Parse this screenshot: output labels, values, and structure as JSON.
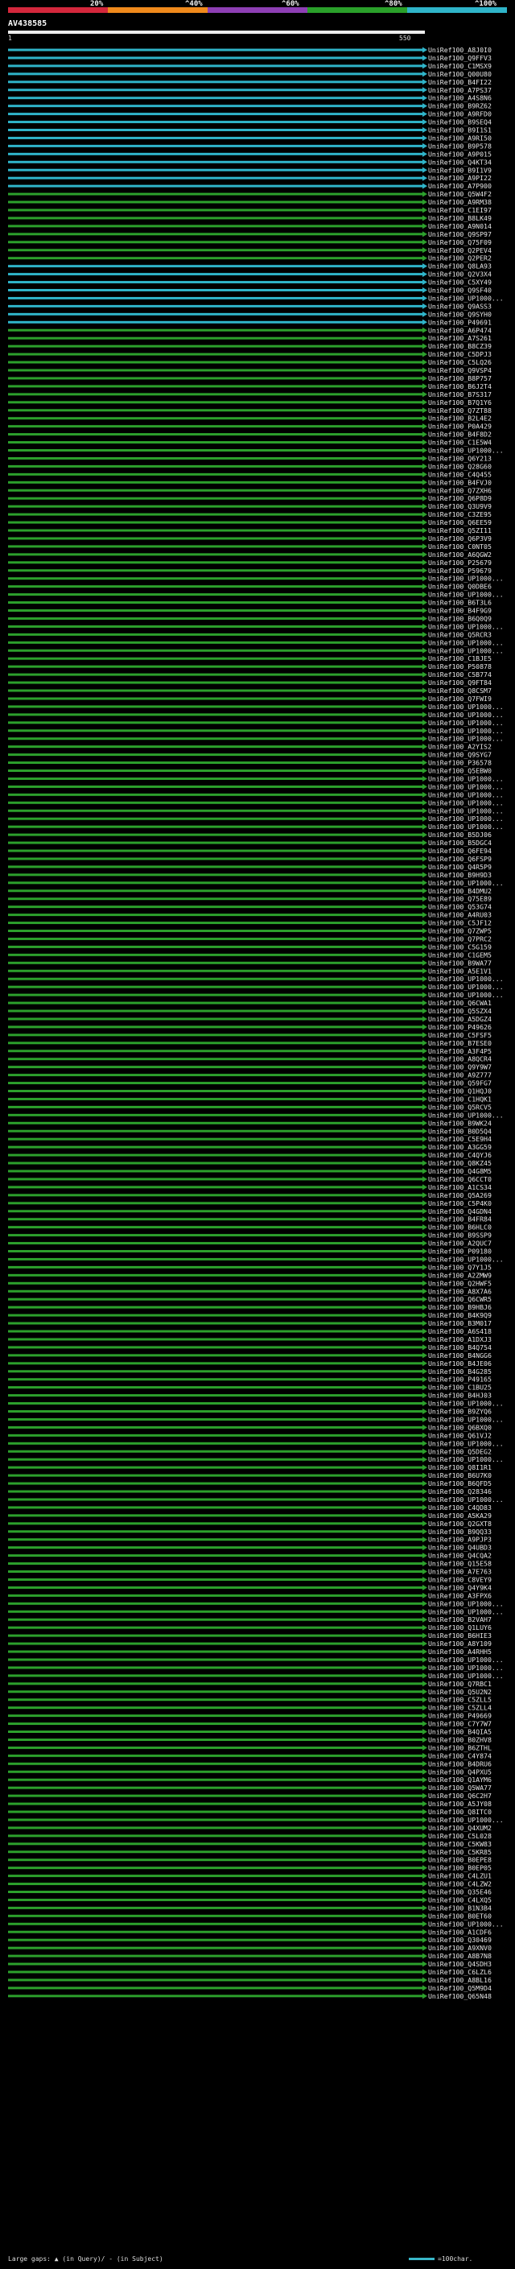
{
  "legend": {
    "labels": [
      "20%",
      "^40%",
      "^60%",
      "^80%",
      "^100%"
    ],
    "colors": [
      "#d4273c",
      "#f08a1c",
      "#8e3fb4",
      "#2aa02a",
      "#2fb4c9"
    ]
  },
  "query": {
    "name": "AV438585",
    "start": "1",
    "end": "550"
  },
  "colors": {
    "high_identity": "#2fb4c9",
    "mid_identity": "#2ca02c",
    "gap_mark": "#dfe7d6"
  },
  "hits": [
    {
      "id": "UniRef100_A8J0I0",
      "cls": "cyan"
    },
    {
      "id": "UniRef100_Q9FFV3",
      "cls": "cyan"
    },
    {
      "id": "UniRef100_C1MSX9",
      "cls": "cyan"
    },
    {
      "id": "UniRef100_Q00U80",
      "cls": "cyan"
    },
    {
      "id": "UniRef100_B4FI22",
      "cls": "cyan"
    },
    {
      "id": "UniRef100_A7PS37",
      "cls": "cyan"
    },
    {
      "id": "UniRef100_A4S8N6",
      "cls": "cyan"
    },
    {
      "id": "UniRef100_B9RZ62",
      "cls": "cyan"
    },
    {
      "id": "UniRef100_A9RFD0",
      "cls": "cyan"
    },
    {
      "id": "UniRef100_B9SEQ4",
      "cls": "cyan"
    },
    {
      "id": "UniRef100_B9I1S1",
      "cls": "cyan"
    },
    {
      "id": "UniRef100_A9RI50",
      "cls": "cyan"
    },
    {
      "id": "UniRef100_B9P578",
      "cls": "cyan"
    },
    {
      "id": "UniRef100_A9P015",
      "cls": "cyan"
    },
    {
      "id": "UniRef100_Q4KT34",
      "cls": "cyan"
    },
    {
      "id": "UniRef100_B9I1V9",
      "cls": "cyan"
    },
    {
      "id": "UniRef100_A9PI22",
      "cls": "cyan"
    },
    {
      "id": "UniRef100_A7P900",
      "cls": "cyan"
    },
    {
      "id": "UniRef100_Q5W4F2",
      "cls": "green"
    },
    {
      "id": "UniRef100_A9RM38",
      "cls": "green"
    },
    {
      "id": "UniRef100_C1EI97",
      "cls": "green"
    },
    {
      "id": "UniRef100_B8LK49",
      "cls": "green"
    },
    {
      "id": "UniRef100_A9N014",
      "cls": "green"
    },
    {
      "id": "UniRef100_Q9SP97",
      "cls": "green"
    },
    {
      "id": "UniRef100_Q75F09",
      "cls": "green"
    },
    {
      "id": "UniRef100_Q2PEV4",
      "cls": "green"
    },
    {
      "id": "UniRef100_Q2PER2",
      "cls": "green"
    },
    {
      "id": "UniRef100_Q8LA93",
      "cls": "cyan"
    },
    {
      "id": "UniRef100_Q2V3X4",
      "cls": "cyan"
    },
    {
      "id": "UniRef100_C5XY49",
      "cls": "cyan"
    },
    {
      "id": "UniRef100_Q9SF40",
      "cls": "cyan"
    },
    {
      "id": "UniRef100_UP1000...",
      "cls": "cyan"
    },
    {
      "id": "UniRef100_Q9ASS3",
      "cls": "cyan"
    },
    {
      "id": "UniRef100_Q9SYH0",
      "cls": "cyan"
    },
    {
      "id": "UniRef100_P49691",
      "cls": "cyan"
    },
    {
      "id": "UniRef100_A6P474",
      "cls": "green"
    },
    {
      "id": "UniRef100_A7S261",
      "cls": "green"
    },
    {
      "id": "UniRef100_B8CZ39",
      "cls": "green"
    },
    {
      "id": "UniRef100_C5DPJ3",
      "cls": "green"
    },
    {
      "id": "UniRef100_C5LQ26",
      "cls": "green"
    },
    {
      "id": "UniRef100_Q9VSP4",
      "cls": "green"
    },
    {
      "id": "UniRef100_B8P757",
      "cls": "green"
    },
    {
      "id": "UniRef100_B6J2T4",
      "cls": "green"
    },
    {
      "id": "UniRef100_B7S317",
      "cls": "green"
    },
    {
      "id": "UniRef100_B7Q1Y6",
      "cls": "green"
    },
    {
      "id": "UniRef100_Q7ZT88",
      "cls": "green"
    },
    {
      "id": "UniRef100_B2L4E2",
      "cls": "green"
    },
    {
      "id": "UniRef100_P0A429",
      "cls": "green"
    },
    {
      "id": "UniRef100_B4F8D2",
      "cls": "green"
    },
    {
      "id": "UniRef100_C1E5W4",
      "cls": "green"
    },
    {
      "id": "UniRef100_UP1000...",
      "cls": "green"
    },
    {
      "id": "UniRef100_Q6Y213",
      "cls": "green"
    },
    {
      "id": "UniRef100_Q28G60",
      "cls": "green"
    },
    {
      "id": "UniRef100_C4Q455",
      "cls": "green"
    },
    {
      "id": "UniRef100_B4FVJ0",
      "cls": "green"
    },
    {
      "id": "UniRef100_Q7ZXH6",
      "cls": "green"
    },
    {
      "id": "UniRef100_Q6P8D9",
      "cls": "green"
    },
    {
      "id": "UniRef100_Q3U9V9",
      "cls": "green"
    },
    {
      "id": "UniRef100_C3ZE95",
      "cls": "green"
    },
    {
      "id": "UniRef100_Q6EE59",
      "cls": "green"
    },
    {
      "id": "UniRef100_Q5ZI11",
      "cls": "green"
    },
    {
      "id": "UniRef100_Q6P3V9",
      "cls": "green"
    },
    {
      "id": "UniRef100_C0NT05",
      "cls": "green"
    },
    {
      "id": "UniRef100_A6QGW2",
      "cls": "green"
    },
    {
      "id": "UniRef100_P25679",
      "cls": "green"
    },
    {
      "id": "UniRef100_P59679",
      "cls": "green"
    },
    {
      "id": "UniRef100_UP1000...",
      "cls": "green"
    },
    {
      "id": "UniRef100_Q0DBE6",
      "cls": "green"
    },
    {
      "id": "UniRef100_UP1000...",
      "cls": "green"
    },
    {
      "id": "UniRef100_B6T3L6",
      "cls": "green"
    },
    {
      "id": "UniRef100_B4F9G9",
      "cls": "green"
    },
    {
      "id": "UniRef100_B6Q0Q9",
      "cls": "green"
    },
    {
      "id": "UniRef100_UP1000...",
      "cls": "green"
    },
    {
      "id": "UniRef100_Q5RCR3",
      "cls": "green"
    },
    {
      "id": "UniRef100_UP1000...",
      "cls": "green"
    },
    {
      "id": "UniRef100_UP1000...",
      "cls": "green"
    },
    {
      "id": "UniRef100_C1BJE5",
      "cls": "green"
    },
    {
      "id": "UniRef100_P50878",
      "cls": "green"
    },
    {
      "id": "UniRef100_C5B774",
      "cls": "green"
    },
    {
      "id": "UniRef100_Q9FT84",
      "cls": "green"
    },
    {
      "id": "UniRef100_Q8CSM7",
      "cls": "green"
    },
    {
      "id": "UniRef100_Q7FWI9",
      "cls": "green"
    },
    {
      "id": "UniRef100_UP1000...",
      "cls": "green"
    },
    {
      "id": "UniRef100_UP1000...",
      "cls": "green"
    },
    {
      "id": "UniRef100_UP1000...",
      "cls": "green"
    },
    {
      "id": "UniRef100_UP1000...",
      "cls": "green"
    },
    {
      "id": "UniRef100_UP1000...",
      "cls": "green"
    },
    {
      "id": "UniRef100_A2YIS2",
      "cls": "green"
    },
    {
      "id": "UniRef100_Q9SYG7",
      "cls": "green"
    },
    {
      "id": "UniRef100_P36578",
      "cls": "green"
    },
    {
      "id": "UniRef100_Q5EBW0",
      "cls": "green"
    },
    {
      "id": "UniRef100_UP1000...",
      "cls": "green"
    },
    {
      "id": "UniRef100_UP1000...",
      "cls": "green"
    },
    {
      "id": "UniRef100_UP1000...",
      "cls": "green"
    },
    {
      "id": "UniRef100_UP1000...",
      "cls": "green"
    },
    {
      "id": "UniRef100_UP1000...",
      "cls": "green"
    },
    {
      "id": "UniRef100_UP1000...",
      "cls": "green"
    },
    {
      "id": "UniRef100_UP1000...",
      "cls": "green"
    },
    {
      "id": "UniRef100_B5DJ06",
      "cls": "green"
    },
    {
      "id": "UniRef100_B5DGC4",
      "cls": "green"
    },
    {
      "id": "UniRef100_Q6FE94",
      "cls": "green"
    },
    {
      "id": "UniRef100_Q6FSP9",
      "cls": "green"
    },
    {
      "id": "UniRef100_Q4R5P9",
      "cls": "green"
    },
    {
      "id": "UniRef100_B9H9D3",
      "cls": "green"
    },
    {
      "id": "UniRef100_UP1000...",
      "cls": "green"
    },
    {
      "id": "UniRef100_B4DMU2",
      "cls": "green"
    },
    {
      "id": "UniRef100_Q75E89",
      "cls": "green"
    },
    {
      "id": "UniRef100_Q53G74",
      "cls": "green"
    },
    {
      "id": "UniRef100_A4RU03",
      "cls": "green"
    },
    {
      "id": "UniRef100_C5JF12",
      "cls": "green"
    },
    {
      "id": "UniRef100_Q7ZWP5",
      "cls": "green"
    },
    {
      "id": "UniRef100_Q7PRC2",
      "cls": "green"
    },
    {
      "id": "UniRef100_C5G159",
      "cls": "green"
    },
    {
      "id": "UniRef100_C1GEM5",
      "cls": "green"
    },
    {
      "id": "UniRef100_B9WA77",
      "cls": "green"
    },
    {
      "id": "UniRef100_A5E1V1",
      "cls": "green"
    },
    {
      "id": "UniRef100_UP1000...",
      "cls": "green"
    },
    {
      "id": "UniRef100_UP1000...",
      "cls": "green"
    },
    {
      "id": "UniRef100_UP1000...",
      "cls": "green"
    },
    {
      "id": "UniRef100_Q6CWA1",
      "cls": "green"
    },
    {
      "id": "UniRef100_Q5SZX4",
      "cls": "green"
    },
    {
      "id": "UniRef100_A5DGZ4",
      "cls": "green"
    },
    {
      "id": "UniRef100_P49626",
      "cls": "green"
    },
    {
      "id": "UniRef100_C5FSF5",
      "cls": "green"
    },
    {
      "id": "UniRef100_B7ESE0",
      "cls": "green"
    },
    {
      "id": "UniRef100_A3F4P5",
      "cls": "green"
    },
    {
      "id": "UniRef100_A8QCR4",
      "cls": "green"
    },
    {
      "id": "UniRef100_Q9Y9W7",
      "cls": "green"
    },
    {
      "id": "UniRef100_A9Z777",
      "cls": "green"
    },
    {
      "id": "UniRef100_Q59FG7",
      "cls": "green"
    },
    {
      "id": "UniRef100_Q1HQJ0",
      "cls": "green"
    },
    {
      "id": "UniRef100_C1HQK1",
      "cls": "green"
    },
    {
      "id": "UniRef100_Q5RCV5",
      "cls": "green"
    },
    {
      "id": "UniRef100_UP1000...",
      "cls": "green"
    },
    {
      "id": "UniRef100_B9WK24",
      "cls": "green"
    },
    {
      "id": "UniRef100_B0D5Q4",
      "cls": "green"
    },
    {
      "id": "UniRef100_C5E9H4",
      "cls": "green"
    },
    {
      "id": "UniRef100_A3GG59",
      "cls": "green"
    },
    {
      "id": "UniRef100_C4QYJ6",
      "cls": "green"
    },
    {
      "id": "UniRef100_Q8KZ45",
      "cls": "green"
    },
    {
      "id": "UniRef100_Q4G8M5",
      "cls": "green"
    },
    {
      "id": "UniRef100_Q6CCT0",
      "cls": "green"
    },
    {
      "id": "UniRef100_A1CS34",
      "cls": "green"
    },
    {
      "id": "UniRef100_Q5A269",
      "cls": "green"
    },
    {
      "id": "UniRef100_C5P4K0",
      "cls": "green"
    },
    {
      "id": "UniRef100_Q4GDN4",
      "cls": "green"
    },
    {
      "id": "UniRef100_B4FR84",
      "cls": "green"
    },
    {
      "id": "UniRef100_B6HLC0",
      "cls": "green"
    },
    {
      "id": "UniRef100_B9SSP9",
      "cls": "green"
    },
    {
      "id": "UniRef100_A2QUC7",
      "cls": "green"
    },
    {
      "id": "UniRef100_P09180",
      "cls": "green"
    },
    {
      "id": "UniRef100_UP1000...",
      "cls": "green"
    },
    {
      "id": "UniRef100_Q7Y1J5",
      "cls": "green"
    },
    {
      "id": "UniRef100_A2ZMW9",
      "cls": "green"
    },
    {
      "id": "UniRef100_Q2HWF5",
      "cls": "green"
    },
    {
      "id": "UniRef100_A8X7A6",
      "cls": "green"
    },
    {
      "id": "UniRef100_Q6CWR5",
      "cls": "green"
    },
    {
      "id": "UniRef100_B9HBJ6",
      "cls": "green"
    },
    {
      "id": "UniRef100_B4K9Q9",
      "cls": "green"
    },
    {
      "id": "UniRef100_B3M017",
      "cls": "green"
    },
    {
      "id": "UniRef100_A6S418",
      "cls": "green"
    },
    {
      "id": "UniRef100_A1DXJ3",
      "cls": "green"
    },
    {
      "id": "UniRef100_B4Q754",
      "cls": "green"
    },
    {
      "id": "UniRef100_B4NGG6",
      "cls": "green"
    },
    {
      "id": "UniRef100_B4JE06",
      "cls": "green"
    },
    {
      "id": "UniRef100_B4G285",
      "cls": "green"
    },
    {
      "id": "UniRef100_P49165",
      "cls": "green"
    },
    {
      "id": "UniRef100_C1BU25",
      "cls": "green"
    },
    {
      "id": "UniRef100_B4HJ03",
      "cls": "green"
    },
    {
      "id": "UniRef100_UP1000...",
      "cls": "green"
    },
    {
      "id": "UniRef100_B9ZYQ6",
      "cls": "green"
    },
    {
      "id": "UniRef100_UP1000...",
      "cls": "green"
    },
    {
      "id": "UniRef100_Q6BXQ0",
      "cls": "green"
    },
    {
      "id": "UniRef100_Q61VJ2",
      "cls": "green"
    },
    {
      "id": "UniRef100_UP1000...",
      "cls": "green"
    },
    {
      "id": "UniRef100_Q5DEG2",
      "cls": "green"
    },
    {
      "id": "UniRef100_UP1000...",
      "cls": "green"
    },
    {
      "id": "UniRef100_Q8I1R1",
      "cls": "green"
    },
    {
      "id": "UniRef100_B6U7K0",
      "cls": "green"
    },
    {
      "id": "UniRef100_B6QFD5",
      "cls": "green"
    },
    {
      "id": "UniRef100_Q28346",
      "cls": "green"
    },
    {
      "id": "UniRef100_UP1000...",
      "cls": "green"
    },
    {
      "id": "UniRef100_C4QD83",
      "cls": "green"
    },
    {
      "id": "UniRef100_A5KA29",
      "cls": "green"
    },
    {
      "id": "UniRef100_Q2GXT8",
      "cls": "green"
    },
    {
      "id": "UniRef100_B9QQ33",
      "cls": "green"
    },
    {
      "id": "UniRef100_A9PJP3",
      "cls": "green"
    },
    {
      "id": "UniRef100_Q4UBD3",
      "cls": "green"
    },
    {
      "id": "UniRef100_Q4CQA2",
      "cls": "green"
    },
    {
      "id": "UniRef100_Q15E58",
      "cls": "green"
    },
    {
      "id": "UniRef100_A7E763",
      "cls": "green"
    },
    {
      "id": "UniRef100_C8VEY9",
      "cls": "green"
    },
    {
      "id": "UniRef100_Q4Y9K4",
      "cls": "green"
    },
    {
      "id": "UniRef100_A3FPX6",
      "cls": "green"
    },
    {
      "id": "UniRef100_UP1000...",
      "cls": "green"
    },
    {
      "id": "UniRef100_UP1000...",
      "cls": "green"
    },
    {
      "id": "UniRef100_B2VAH7",
      "cls": "green"
    },
    {
      "id": "UniRef100_Q1LUY6",
      "cls": "green"
    },
    {
      "id": "UniRef100_B6HIE3",
      "cls": "green"
    },
    {
      "id": "UniRef100_A8Y109",
      "cls": "green"
    },
    {
      "id": "UniRef100_A4RHH5",
      "cls": "green"
    },
    {
      "id": "UniRef100_UP1000...",
      "cls": "green"
    },
    {
      "id": "UniRef100_UP1000...",
      "cls": "green"
    },
    {
      "id": "UniRef100_UP1000...",
      "cls": "green"
    },
    {
      "id": "UniRef100_Q7RBC1",
      "cls": "green"
    },
    {
      "id": "UniRef100_Q5U2N2",
      "cls": "green"
    },
    {
      "id": "UniRef100_C5ZLL5",
      "cls": "green"
    },
    {
      "id": "UniRef100_C5ZLL4",
      "cls": "green"
    },
    {
      "id": "UniRef100_P49669",
      "cls": "green"
    },
    {
      "id": "UniRef100_C7Y7W7",
      "cls": "green"
    },
    {
      "id": "UniRef100_B4QIA5",
      "cls": "green"
    },
    {
      "id": "UniRef100_B0ZHV8",
      "cls": "green"
    },
    {
      "id": "UniRef100_B6ZTHL",
      "cls": "green"
    },
    {
      "id": "UniRef100_C4Y874",
      "cls": "green"
    },
    {
      "id": "UniRef100_B4DRU6",
      "cls": "green"
    },
    {
      "id": "UniRef100_Q4PXU5",
      "cls": "green"
    },
    {
      "id": "UniRef100_Q1AYM6",
      "cls": "green"
    },
    {
      "id": "UniRef100_Q5WA77",
      "cls": "green"
    },
    {
      "id": "UniRef100_Q6C2H7",
      "cls": "green"
    },
    {
      "id": "UniRef100_A5JY08",
      "cls": "green"
    },
    {
      "id": "UniRef100_Q8ITC0",
      "cls": "green"
    },
    {
      "id": "UniRef100_UP1000...",
      "cls": "green"
    },
    {
      "id": "UniRef100_Q4XUM2",
      "cls": "green"
    },
    {
      "id": "UniRef100_C5L028",
      "cls": "green"
    },
    {
      "id": "UniRef100_C5KW83",
      "cls": "green"
    },
    {
      "id": "UniRef100_C5KR85",
      "cls": "green"
    },
    {
      "id": "UniRef100_B0EPE8",
      "cls": "green"
    },
    {
      "id": "UniRef100_B0EP05",
      "cls": "green"
    },
    {
      "id": "UniRef100_C4LZU1",
      "cls": "green"
    },
    {
      "id": "UniRef100_C4LZW2",
      "cls": "green"
    },
    {
      "id": "UniRef100_Q35E46",
      "cls": "green"
    },
    {
      "id": "UniRef100_C4LXQ5",
      "cls": "green"
    },
    {
      "id": "UniRef100_B1N3B4",
      "cls": "green"
    },
    {
      "id": "UniRef100_B0ET60",
      "cls": "green"
    },
    {
      "id": "UniRef100_UP1000...",
      "cls": "green"
    },
    {
      "id": "UniRef100_A1CDF6",
      "cls": "green"
    },
    {
      "id": "UniRef100_Q30469",
      "cls": "green"
    },
    {
      "id": "UniRef100_A9XNV0",
      "cls": "green"
    },
    {
      "id": "UniRef100_A8B7N8",
      "cls": "green"
    },
    {
      "id": "UniRef100_Q4SDH3",
      "cls": "green"
    },
    {
      "id": "UniRef100_C6LZL6",
      "cls": "green"
    },
    {
      "id": "UniRef100_A8BL16",
      "cls": "green"
    },
    {
      "id": "UniRef100_Q5M9D4",
      "cls": "green"
    },
    {
      "id": "UniRef100_Q65N48",
      "cls": "green"
    }
  ],
  "footer": {
    "large_gaps": "Large gaps: ▲ (in Query)/ - (in Subject)",
    "scale": "=100char."
  }
}
